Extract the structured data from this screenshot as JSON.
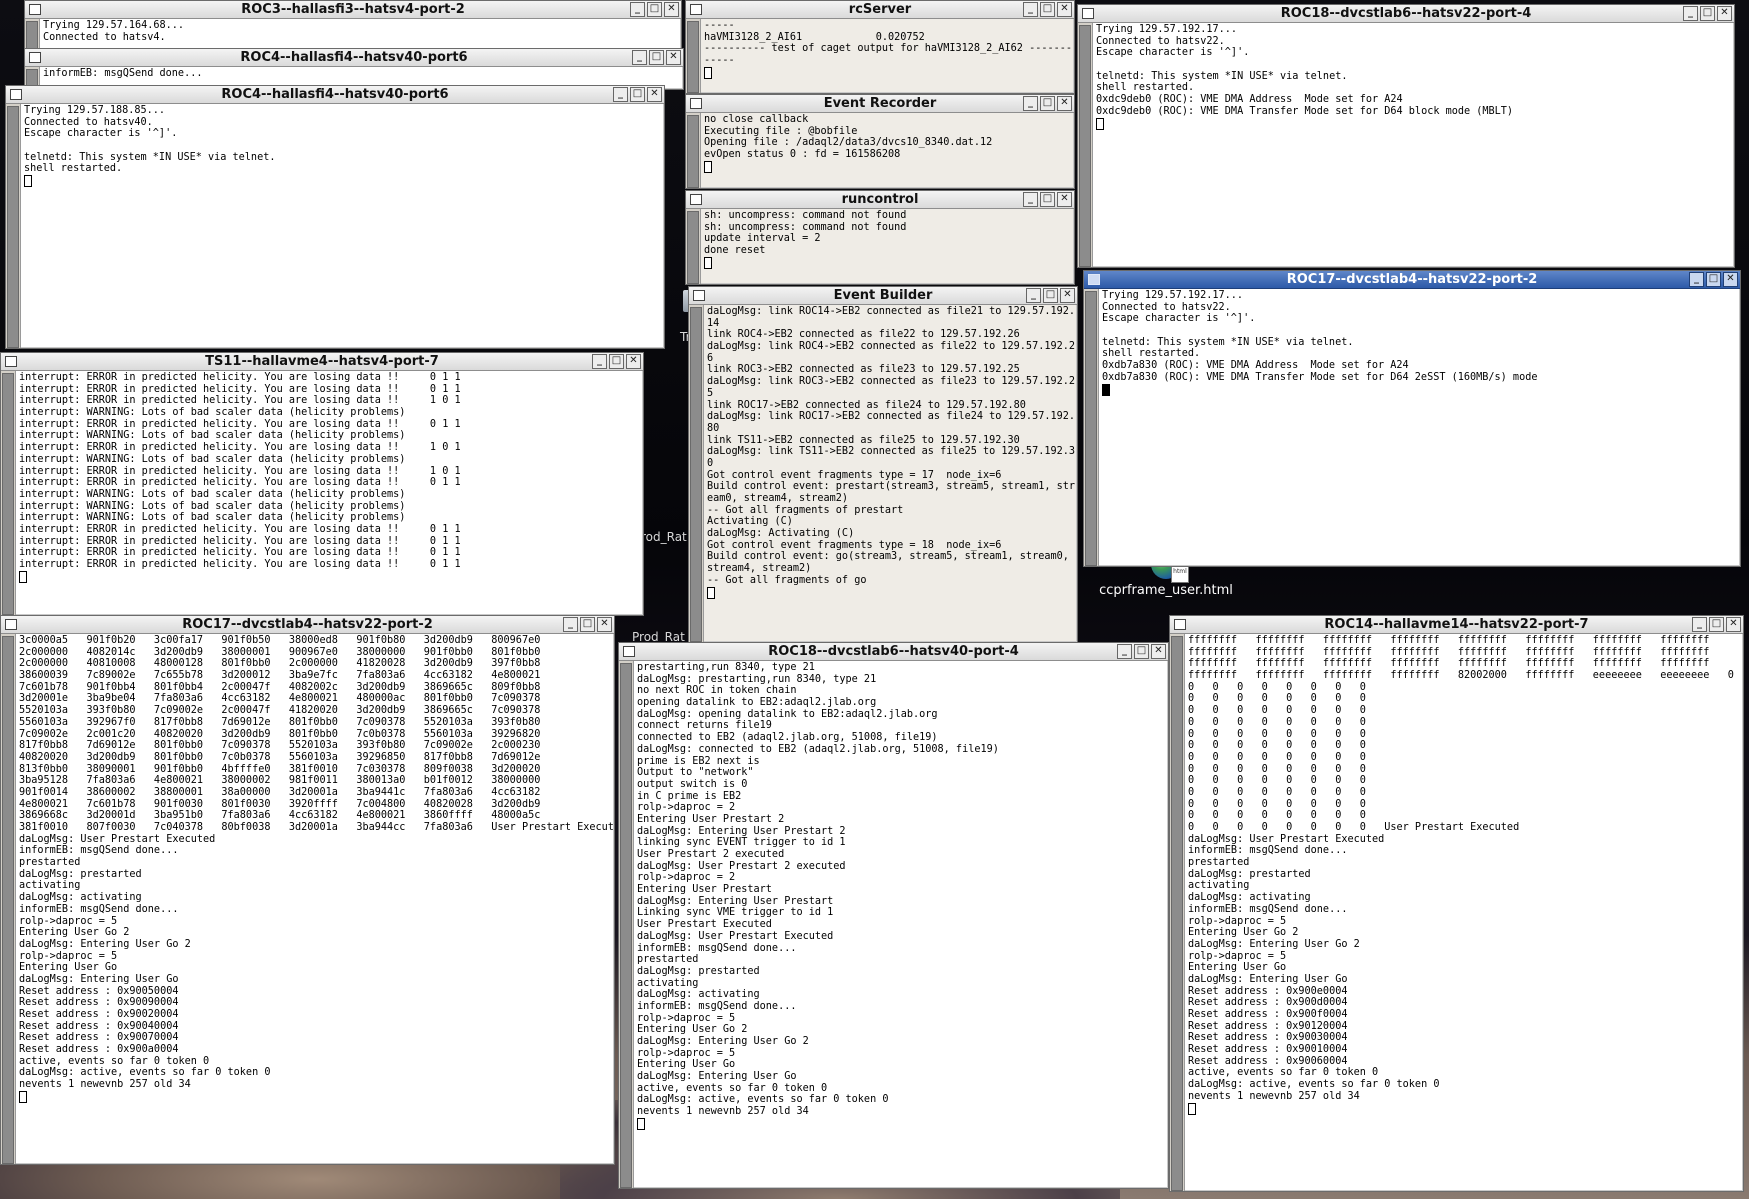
{
  "desktop": {
    "icon_label": "ccprframe_user.html",
    "icon_doc_text": "html",
    "bg_labels": [
      "Tr",
      "rod_Rat",
      "Prod_Rat"
    ]
  },
  "windows": [
    {
      "id": "roc3-port2",
      "title": "ROC3--hallasfi3--hatsv4-port-2",
      "active": false,
      "lines": [
        "Trying 129.57.164.68...",
        "Connected to hatsv4."
      ],
      "cursor": false
    },
    {
      "id": "roc4-port6-back",
      "title": "ROC4--hallasfi4--hatsv40-port6",
      "active": false,
      "lines": [
        "informEB: msgQSend done..."
      ],
      "cursor": false
    },
    {
      "id": "roc4-port6",
      "title": "ROC4--hallasfi4--hatsv40-port6",
      "active": false,
      "lines": [
        "Trying 129.57.188.85...",
        "Connected to hatsv40.",
        "Escape character is '^]'.",
        "",
        "telnetd: This system *IN USE* via telnet.",
        "shell restarted."
      ],
      "cursor": true
    },
    {
      "id": "rcserver",
      "title": "rcServer",
      "active": false,
      "lines": [
        "-----",
        "haVMI3128_2_AI61            0.020752",
        "---------- test of caget output for haVMI3128_2_AI62 -------",
        "-----"
      ],
      "cursor": true
    },
    {
      "id": "event-recorder",
      "title": "Event Recorder",
      "active": false,
      "lines": [
        "no close callback",
        "Executing file : @bobfile",
        "Opening file : /adaql2/data3/dvcs10_8340.dat.12",
        "evOpen status 0 : fd = 161586208"
      ],
      "cursor": true
    },
    {
      "id": "runcontrol",
      "title": "runcontrol",
      "active": false,
      "lines": [
        "sh: uncompress: command not found",
        "sh: uncompress: command not found",
        "update interval = 2",
        "done reset"
      ],
      "cursor": true
    },
    {
      "id": "event-builder",
      "title": "Event Builder",
      "active": false,
      "lines": [
        "daLogMsg: link ROC14->EB2 connected as file21 to 129.57.192.",
        "14",
        "link ROC4->EB2 connected as file22 to 129.57.192.26",
        "daLogMsg: link ROC4->EB2 connected as file22 to 129.57.192.2",
        "6",
        "link ROC3->EB2 connected as file23 to 129.57.192.25",
        "daLogMsg: link ROC3->EB2 connected as file23 to 129.57.192.2",
        "5",
        "link ROC17->EB2 connected as file24 to 129.57.192.80",
        "daLogMsg: link ROC17->EB2 connected as file24 to 129.57.192.",
        "80",
        "link TS11->EB2 connected as file25 to 129.57.192.30",
        "daLogMsg: link TS11->EB2 connected as file25 to 129.57.192.3",
        "0",
        "Got control event fragments type = 17  node_ix=6",
        "Build control event: prestart(stream3, stream5, stream1, str",
        "eam0, stream4, stream2)",
        "-- Got all fragments of prestart",
        "Activating (C)",
        "daLogMsg: Activating (C)",
        "Got control event fragments type = 18  node_ix=6",
        "Build control event: go(stream3, stream5, stream1, stream0,",
        "stream4, stream2)",
        "-- Got all fragments of go"
      ],
      "cursor": true
    },
    {
      "id": "roc18-port4",
      "title": "ROC18--dvcstlab6--hatsv22-port-4",
      "active": false,
      "lines": [
        "Trying 129.57.192.17...",
        "Connected to hatsv22.",
        "Escape character is '^]'.",
        "",
        "telnetd: This system *IN USE* via telnet.",
        "shell restarted.",
        "0xdc9deb0 (ROC): VME DMA Address  Mode set for A24",
        "0xdc9deb0 (ROC): VME DMA Transfer Mode set for D64 block mode (MBLT)"
      ],
      "cursor": true
    },
    {
      "id": "roc17-hatsv22-port2-top",
      "title": "ROC17--dvcstlab4--hatsv22-port-2",
      "active": true,
      "lines": [
        "Trying 129.57.192.17...",
        "Connected to hatsv22.",
        "Escape character is '^]'.",
        "",
        "telnetd: This system *IN USE* via telnet.",
        "shell restarted.",
        "0xdb7a830 (ROC): VME DMA Address  Mode set for A24",
        "0xdb7a830 (ROC): VME DMA Transfer Mode set for D64 2eSST (160MB/s) mode"
      ],
      "cursor": true
    },
    {
      "id": "ts11-port7",
      "title": "TS11--hallavme4--hatsv4-port-7",
      "active": false,
      "lines": [
        "interrupt: ERROR in predicted helicity. You are losing data !!     0 1 1",
        "interrupt: ERROR in predicted helicity. You are losing data !!     0 1 1",
        "interrupt: ERROR in predicted helicity. You are losing data !!     1 0 1",
        "interrupt: WARNING: Lots of bad scaler data (helicity problems)",
        "interrupt: ERROR in predicted helicity. You are losing data !!     0 1 1",
        "interrupt: WARNING: Lots of bad scaler data (helicity problems)",
        "interrupt: ERROR in predicted helicity. You are losing data !!     1 0 1",
        "interrupt: WARNING: Lots of bad scaler data (helicity problems)",
        "interrupt: ERROR in predicted helicity. You are losing data !!     1 0 1",
        "interrupt: ERROR in predicted helicity. You are losing data !!     0 1 1",
        "interrupt: WARNING: Lots of bad scaler data (helicity problems)",
        "interrupt: WARNING: Lots of bad scaler data (helicity problems)",
        "interrupt: WARNING: Lots of bad scaler data (helicity problems)",
        "interrupt: ERROR in predicted helicity. You are losing data !!     0 1 1",
        "interrupt: ERROR in predicted helicity. You are losing data !!     0 1 1",
        "interrupt: ERROR in predicted helicity. You are losing data !!     0 1 1",
        "interrupt: ERROR in predicted helicity. You are losing data !!     0 1 1"
      ],
      "cursor": true
    },
    {
      "id": "roc17-hatsv22-port2-bottom",
      "title": "ROC17--dvcstlab4--hatsv22-port-2",
      "active": false,
      "lines": [
        "3c0000a5   901f0b20   3c00fa17   901f0b50   38000ed8   901f0b80   3d200db9   800967e0",
        "2c000000   4082014c   3d200db9   38000001   900967e0   38000000   901f0bb0   801f0bb0",
        "2c000000   40810008   48000128   801f0bb0   2c000000   41820028   3d200db9   397f0bb8",
        "38600039   7c89002e   7c655b78   3d200012   3ba9e7fc   7fa803a6   4cc63182   4e800021",
        "7c601b78   901f0bb4   801f0bb4   2c00047f   4082002c   3d200db9   3869665c   809f0bb8",
        "3d20001e   3ba9be04   7fa803a6   4cc63182   4e800021   480000ac   801f0bb0   7c090378",
        "5520103a   393f0b80   7c09002e   2c00047f   41820020   3d200db9   3869665c   7c090378",
        "5560103a   392967f0   817f0bb8   7d69012e   801f0bb0   7c090378   5520103a   393f0b80",
        "7c09002e   2c001c20   40820020   3d200db9   801f0bb0   7c0b0378   5560103a   39296820",
        "817f0bb8   7d69012e   801f0bb0   7c090378   5520103a   393f0b80   7c09002e   2c000230",
        "40820020   3d200db9   801f0bb0   7c0b0378   5560103a   39296850   817f0bb8   7d69012e",
        "813f0bb0   38090001   901f0bb0   4bffffe0   381f0010   7c030378   809f0038   3d200020",
        "3ba95128   7fa803a6   4e800021   38000002   981f0011   380013a0   b01f0012   38000000",
        "901f0014   38600002   38800001   38a00000   3d20001a   3ba9441c   7fa803a6   4cc63182",
        "4e800021   7c601b78   901f0030   801f0030   3920ffff   7c004800   40820028   3d200db9",
        "3869668c   3d20001d   3ba951b0   7fa803a6   4cc63182   4e800021   3860ffff   48000a5c",
        "381f0010   807f0030   7c040378   80bf0038   3d20001a   3ba944cc   7fa803a6   User Prestart Executed",
        "daLogMsg: User Prestart Executed",
        "informEB: msgQSend done...",
        "prestarted",
        "daLogMsg: prestarted",
        "activating",
        "daLogMsg: activating",
        "informEB: msgQSend done...",
        "rolp->daproc = 5",
        "Entering User Go 2",
        "daLogMsg: Entering User Go 2",
        "rolp->daproc = 5",
        "Entering User Go",
        "daLogMsg: Entering User Go",
        "Reset address : 0x90050004",
        "Reset address : 0x90090004",
        "Reset address : 0x90020004",
        "Reset address : 0x90040004",
        "Reset address : 0x90070004",
        "Reset address : 0x900a0004",
        "active, events so far 0 token 0",
        "daLogMsg: active, events so far 0 token 0",
        "nevents 1 newevnb 257 old 34"
      ],
      "cursor": true
    },
    {
      "id": "roc18-hatsv40-port4",
      "title": "ROC18--dvcstlab6--hatsv40-port-4",
      "active": false,
      "lines": [
        "prestarting,run 8340, type 21",
        "daLogMsg: prestarting,run 8340, type 21",
        "no next ROC in token chain",
        "opening datalink to EB2:adaql2.jlab.org",
        "daLogMsg: opening datalink to EB2:adaql2.jlab.org",
        "connect returns file19",
        "connected to EB2 (adaql2.jlab.org, 51008, file19)",
        "daLogMsg: connected to EB2 (adaql2.jlab.org, 51008, file19)",
        "prime is EB2 next is",
        "Output to \"network\"",
        "output switch is 0",
        "in C prime is EB2",
        "rolp->daproc = 2",
        "Entering User Prestart 2",
        "daLogMsg: Entering User Prestart 2",
        "linking sync EVENT trigger to id 1",
        "User Prestart 2 executed",
        "daLogMsg: User Prestart 2 executed",
        "rolp->daproc = 2",
        "Entering User Prestart",
        "daLogMsg: Entering User Prestart",
        "Linking sync VME trigger to id 1",
        "User Prestart Executed",
        "daLogMsg: User Prestart Executed",
        "informEB: msgQSend done...",
        "prestarted",
        "daLogMsg: prestarted",
        "activating",
        "daLogMsg: activating",
        "informEB: msgQSend done...",
        "rolp->daproc = 5",
        "Entering User Go 2",
        "daLogMsg: Entering User Go 2",
        "rolp->daproc = 5",
        "Entering User Go",
        "daLogMsg: Entering User Go",
        "active, events so far 0 token 0",
        "daLogMsg: active, events so far 0 token 0",
        "nevents 1 newevnb 257 old 34"
      ],
      "cursor": true
    },
    {
      "id": "roc14-port7",
      "title": "ROC14--hallavme14--hatsv22-port-7",
      "active": false,
      "lines": [
        "ffffffff   ffffffff   ffffffff   ffffffff   ffffffff   ffffffff   ffffffff   ffffffff",
        "ffffffff   ffffffff   ffffffff   ffffffff   ffffffff   ffffffff   ffffffff   ffffffff",
        "ffffffff   ffffffff   ffffffff   ffffffff   ffffffff   ffffffff   ffffffff   ffffffff",
        "ffffffff   ffffffff   ffffffff   ffffffff   82002000   ffffffff   eeeeeeee   eeeeeeee   0",
        "0   0   0   0   0   0   0   0",
        "0   0   0   0   0   0   0   0",
        "0   0   0   0   0   0   0   0",
        "0   0   0   0   0   0   0   0",
        "0   0   0   0   0   0   0   0",
        "0   0   0   0   0   0   0   0",
        "0   0   0   0   0   0   0   0",
        "0   0   0   0   0   0   0   0",
        "0   0   0   0   0   0   0   0",
        "0   0   0   0   0   0   0   0",
        "0   0   0   0   0   0   0   0",
        "0   0   0   0   0   0   0   0",
        "0   0   0   0   0   0   0   0   User Prestart Executed",
        "daLogMsg: User Prestart Executed",
        "informEB: msgQSend done...",
        "prestarted",
        "daLogMsg: prestarted",
        "activating",
        "daLogMsg: activating",
        "informEB: msgQSend done...",
        "rolp->daproc = 5",
        "Entering User Go 2",
        "daLogMsg: Entering User Go 2",
        "rolp->daproc = 5",
        "Entering User Go",
        "daLogMsg: Entering User Go",
        "Reset address : 0x900e0004",
        "Reset address : 0x900d0004",
        "Reset address : 0x900f0004",
        "Reset address : 0x90120004",
        "Reset address : 0x90030004",
        "Reset address : 0x90010004",
        "Reset address : 0x90060004",
        "active, events so far 0 token 0",
        "daLogMsg: active, events so far 0 token 0",
        "nevents 1 newevnb 257 old 34"
      ],
      "cursor": true
    }
  ]
}
